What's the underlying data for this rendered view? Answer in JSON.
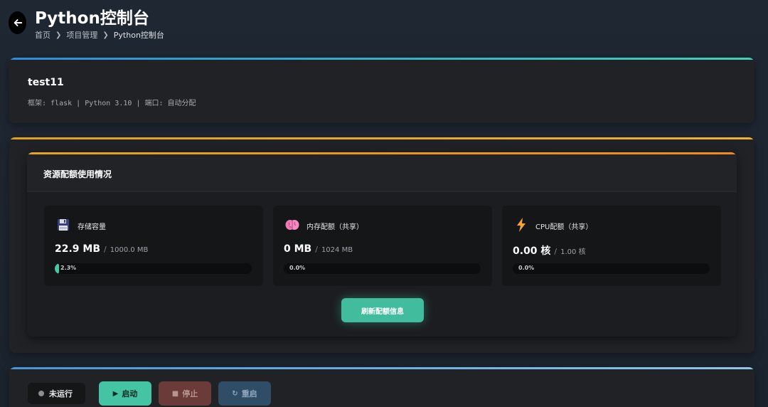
{
  "header": {
    "title": "Python控制台",
    "breadcrumb": [
      "首页",
      "项目管理",
      "Python控制台"
    ]
  },
  "project": {
    "name": "test11",
    "meta": "框架: flask | Python 3.10 | 端口: 自动分配"
  },
  "quota": {
    "title": "资源配额使用情况",
    "metrics": [
      {
        "label": "存储容量",
        "used": "22.9 MB",
        "total": "1000.0 MB",
        "percent_text": "2.3%",
        "percent": 2.3,
        "icon": "floppy-disk-icon"
      },
      {
        "label": "内存配额（共享）",
        "used": "0 MB",
        "total": "1024 MB",
        "percent_text": "0.0%",
        "percent": 0.0,
        "icon": "brain-icon"
      },
      {
        "label": "CPU配额（共享）",
        "used": "0.00 核",
        "total": "1.00 核",
        "percent_text": "0.0%",
        "percent": 0.0,
        "icon": "lightning-icon"
      }
    ],
    "refresh_label": "刷新配额信息"
  },
  "controls": {
    "status": "未运行",
    "start_label": "启动",
    "stop_label": "停止",
    "restart_label": "重启"
  },
  "colors": {
    "accent": "#41bc9d",
    "card_bg": "#212226",
    "stop": "#6a3b38",
    "restart": "#2f4d67"
  }
}
